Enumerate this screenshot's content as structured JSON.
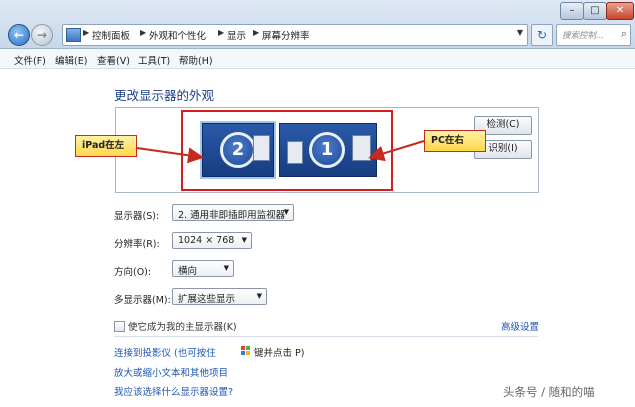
{
  "address_bar": {
    "breadcrumbs": [
      "控制面板",
      "外观和个性化",
      "显示",
      "屏幕分辨率"
    ]
  },
  "search": {
    "placeholder": "搜索控制..."
  },
  "menu": [
    "文件(F)",
    "编辑(E)",
    "查看(V)",
    "工具(T)",
    "帮助(H)"
  ],
  "page": {
    "title": "更改显示器的外观"
  },
  "monitors": [
    {
      "number": "2"
    },
    {
      "number": "1"
    }
  ],
  "buttons": {
    "detect": "检测(C)",
    "identify": "识别(I)"
  },
  "callouts": {
    "ipad": "iPad在左",
    "pc": "PC在右"
  },
  "form": {
    "display_label": "显示器(S):",
    "display_value": "2. 通用非即插即用监视器",
    "resolution_label": "分辨率(R):",
    "resolution_value": "1024 × 768",
    "orientation_label": "方向(O):",
    "orientation_value": "横向",
    "multi_label": "多显示器(M):",
    "multi_value": "扩展这些显示"
  },
  "primary_checkbox_label": "使它成为我的主显示器(K)",
  "links": {
    "advanced": "高级设置",
    "projector": "连接到投影仪 (也可按住",
    "projector_tail": "键并点击 P)",
    "text_size": "放大或缩小文本和其他项目",
    "which_settings": "我应该选择什么显示器设置?"
  },
  "watermark": "头条号 / 随和的喵",
  "colors": {
    "callout_border": "#c62a1f",
    "highlight": "#d41e1e",
    "link": "#1f56b3"
  }
}
